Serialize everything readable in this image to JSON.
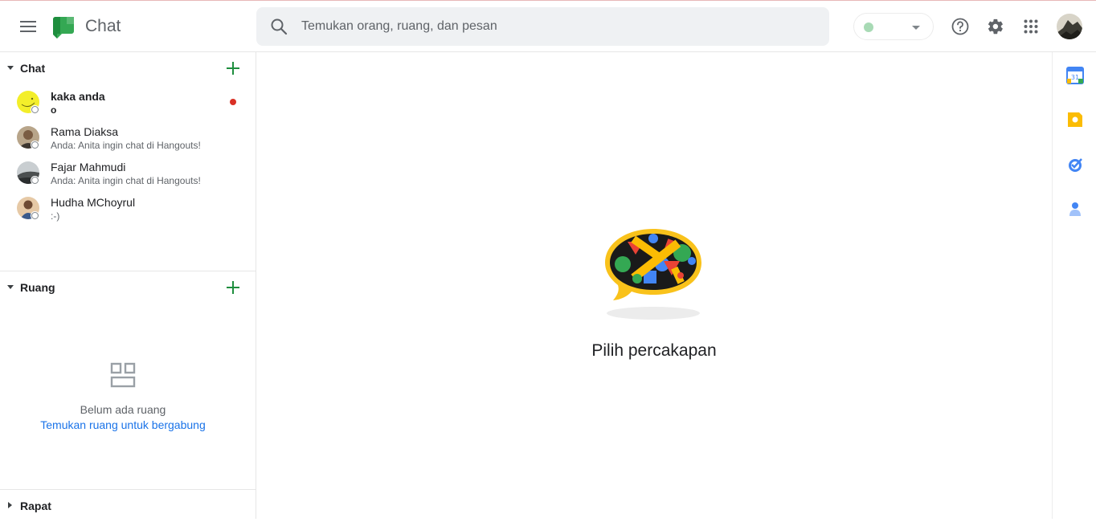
{
  "header": {
    "app_title": "Chat",
    "search_placeholder": "Temukan orang, ruang, dan pesan"
  },
  "sidebar": {
    "chat_section": {
      "label": "Chat",
      "items": [
        {
          "name": "kaka anda",
          "snippet": "o",
          "unread": true
        },
        {
          "name": "Rama Diaksa",
          "snippet": "Anda: Anita ingin chat di Hangouts!",
          "unread": false
        },
        {
          "name": "Fajar Mahmudi",
          "snippet": "Anda: Anita ingin chat di Hangouts!",
          "unread": false
        },
        {
          "name": "Hudha MChoyrul",
          "snippet": ":-)",
          "unread": false
        }
      ]
    },
    "rooms_section": {
      "label": "Ruang",
      "empty_title": "Belum ada ruang",
      "empty_link": "Temukan ruang untuk bergabung"
    },
    "meet_section": {
      "label": "Rapat"
    }
  },
  "main": {
    "empty_title": "Pilih percakapan"
  },
  "icons": {
    "menu": "hamburger-menu-icon",
    "search": "search-icon",
    "help": "help-icon",
    "settings": "gear-icon",
    "apps": "apps-grid-icon",
    "rail": [
      "calendar-icon",
      "keep-icon",
      "tasks-icon",
      "contacts-icon"
    ]
  },
  "colors": {
    "accent_green": "#1e8e3e",
    "link_blue": "#1a73e8",
    "unread_red": "#d93025",
    "status_green": "#a8dab5"
  }
}
